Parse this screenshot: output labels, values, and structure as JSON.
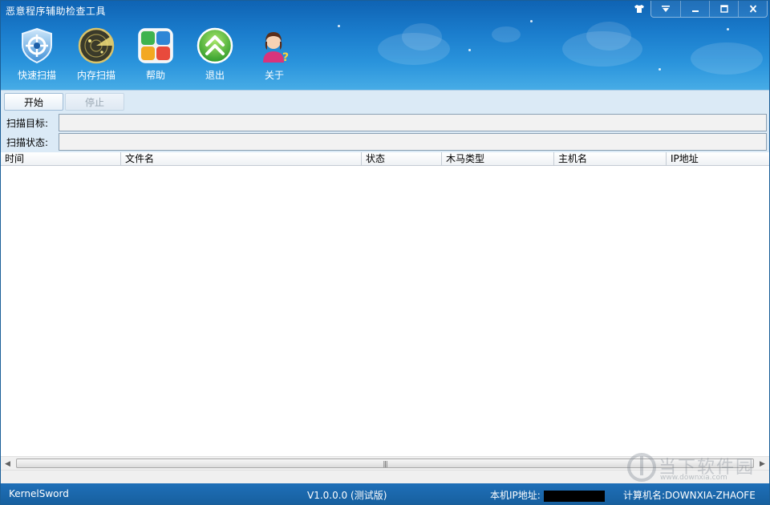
{
  "window": {
    "title": "恶意程序辅助检查工具"
  },
  "toolbar": {
    "items": [
      {
        "label": "快速扫描",
        "icon": "shield-crosshair-icon"
      },
      {
        "label": "内存扫描",
        "icon": "radar-icon"
      },
      {
        "label": "帮助",
        "icon": "help-grid-icon"
      },
      {
        "label": "退出",
        "icon": "exit-arrows-icon"
      },
      {
        "label": "关于",
        "icon": "user-question-icon"
      }
    ]
  },
  "controls": {
    "start_label": "开始",
    "stop_label": "停止",
    "scan_target_label": "扫描目标:",
    "scan_target_value": "",
    "scan_status_label": "扫描状态:",
    "scan_status_value": ""
  },
  "table": {
    "columns": [
      "时间",
      "文件名",
      "状态",
      "木马类型",
      "主机名",
      "IP地址"
    ],
    "rows": []
  },
  "statusbar": {
    "product": "KernelSword",
    "version": "V1.0.0.0 (测试版)",
    "ip_label": "本机IP地址:",
    "computer_label": "计算机名:",
    "computer_name": "DOWNXIA-ZHAOFE"
  },
  "watermark": {
    "text": "当下软件园",
    "url": "www.downxia.com"
  },
  "colors": {
    "header_top": "#0f63b3",
    "header_bottom": "#47ace6",
    "statusbar": "#1f6fb8",
    "strip": "#dbeaf6"
  }
}
